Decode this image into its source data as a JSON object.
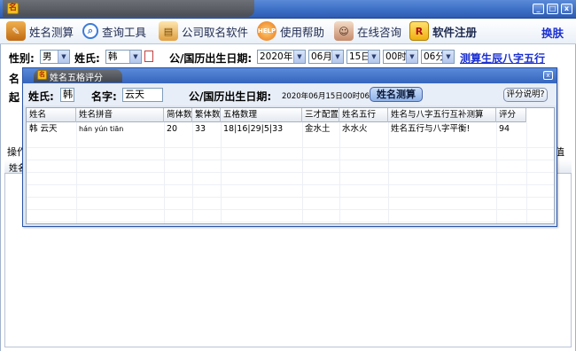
{
  "toolbar": {
    "items": [
      {
        "label": "姓名测算",
        "icon": "pencil-book-icon",
        "color": "#d47a1c"
      },
      {
        "label": "查询工具",
        "icon": "magnifier-icon",
        "color": "#3d7bd8"
      },
      {
        "label": "公司取名软件",
        "icon": "company-card-icon",
        "color": "#e0a040"
      },
      {
        "label": "使用帮助",
        "icon": "help-icon",
        "color": "#e8731a"
      },
      {
        "label": "在线咨询",
        "icon": "consultant-icon",
        "color": "#c58a6a"
      },
      {
        "label": "软件注册",
        "icon": "register-icon",
        "color": "#f0c020"
      }
    ],
    "skin": "换肤"
  },
  "form": {
    "gender_label": "性别:",
    "gender_value": "男",
    "surname_label": "姓氏:",
    "surname_value": "韩",
    "birth_label": "公/国历出生日期:",
    "year": "2020年",
    "month": "06月",
    "day": "15日",
    "hour": "00时",
    "minute": "06分",
    "bazi_link": "测算生辰八字五行"
  },
  "background_fragments": {
    "name_frag": "名",
    "start_frag": "起",
    "op_frag": "操作",
    "name2_frag": "姓名",
    "right_frag": "值"
  },
  "dialog": {
    "title": "姓名五格评分",
    "surname_label": "姓氏:",
    "surname_value": "韩",
    "given_label": "名字:",
    "given_value": "云天",
    "birth_label": "公/国历出生日期:",
    "birth_value": "2020年06月15日00时06分",
    "calc_button": "姓名测算",
    "score_help_button": "评分说明?",
    "columns": [
      "姓名",
      "姓名拼音",
      "简体数",
      "繁体数",
      "五格数理",
      "三才配置",
      "姓名五行",
      "姓名与八字五行互补测算",
      "评分"
    ],
    "rows": [
      [
        "韩 云天",
        "hán yún tiān",
        "20",
        "33",
        "18|16|29|5|33",
        "金水土",
        "水水火",
        "姓名五行与八字平衡!",
        "94"
      ]
    ]
  }
}
